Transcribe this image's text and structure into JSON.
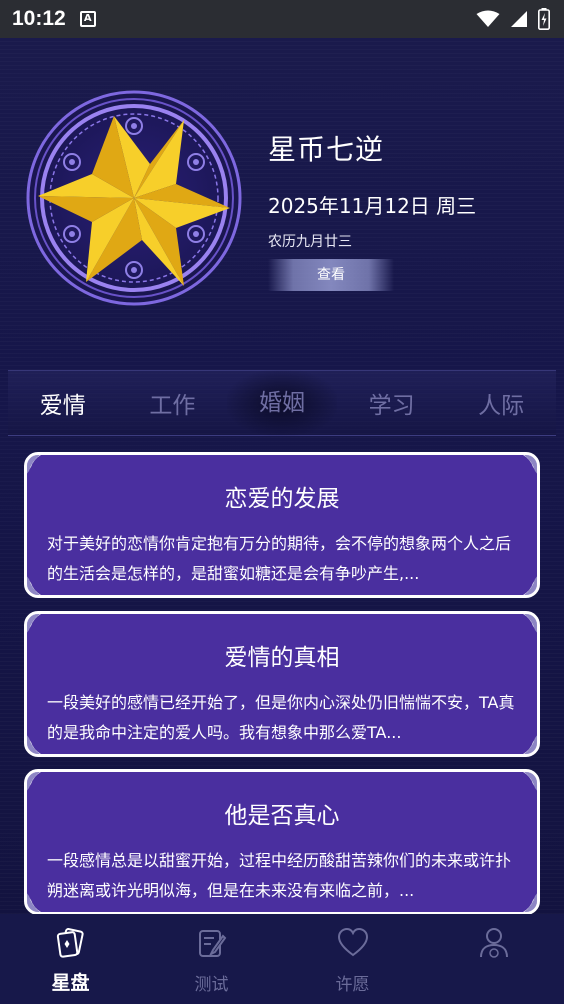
{
  "status_bar": {
    "time": "10:12",
    "notif_glyph": "A"
  },
  "header": {
    "app_title": "星币七逆",
    "date": "2025年11月12日 周三",
    "lunar_date": "农历九月廿三",
    "view_button": "查看"
  },
  "tabs": [
    {
      "label": "爱情",
      "active": true
    },
    {
      "label": "工作",
      "active": false
    },
    {
      "label": "婚姻",
      "active": false
    },
    {
      "label": "学习",
      "active": false
    },
    {
      "label": "人际",
      "active": false
    }
  ],
  "cards": [
    {
      "title": "恋爱的发展",
      "body": "对于美好的恋情你肯定抱有万分的期待，会不停的想象两个人之后的生活会是怎样的，是甜蜜如糖还是会有争吵产生,..."
    },
    {
      "title": "爱情的真相",
      "body": "一段美好的感情已经开始了，但是你内心深处仍旧惴惴不安，TA真的是我命中注定的爱人吗。我有想象中那么爱TA..."
    },
    {
      "title": "他是否真心",
      "body": "一段感情总是以甜蜜开始，过程中经历酸甜苦辣你们的未来或许扑朔迷离或许光明似海，但是在未来没有来临之前，..."
    }
  ],
  "bottom_nav": [
    {
      "label": "星盘",
      "icon": "cards-icon",
      "active": true
    },
    {
      "label": "测试",
      "icon": "edit-icon",
      "active": false
    },
    {
      "label": "许愿",
      "icon": "heart-icon",
      "active": false
    },
    {
      "label": "",
      "icon": "profile-icon",
      "active": false
    }
  ],
  "colors": {
    "background": "#16164a",
    "card": "#4a2f9f",
    "star": "#f5c320",
    "tab_inactive": "#6f6ea3"
  }
}
